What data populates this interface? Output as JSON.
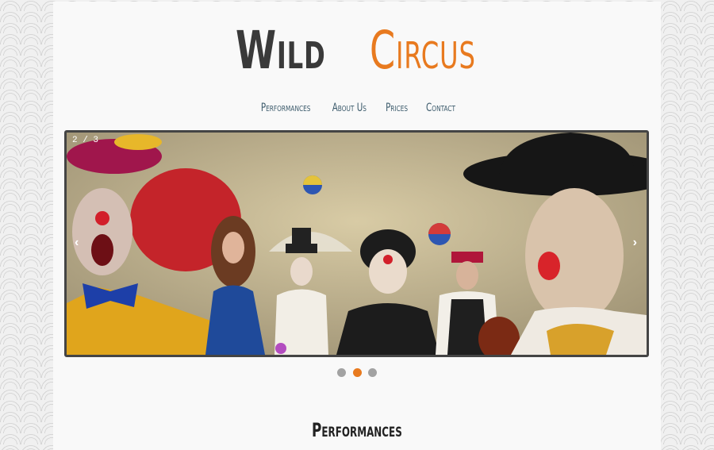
{
  "logo": {
    "word1": "Wild",
    "word2": "Circus"
  },
  "nav": {
    "items": [
      "Performances",
      "About Us",
      "Prices",
      "Contact"
    ]
  },
  "slider": {
    "counter": "2 / 3",
    "prev_icon": "chevron-left-icon",
    "next_icon": "chevron-right-icon",
    "prev_glyph": "‹",
    "next_glyph": "›",
    "image_subject": "clowns-group-photo",
    "total_slides": 3,
    "active_slide": 2
  },
  "colors": {
    "accent": "#e87a1f",
    "dark": "#3a3a3a",
    "nav": "#3b5a6b"
  },
  "section": {
    "title": "Performances"
  }
}
